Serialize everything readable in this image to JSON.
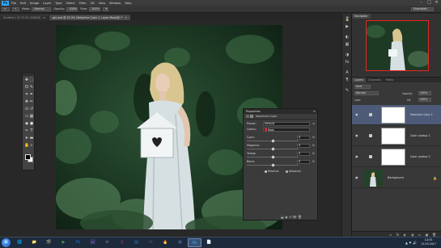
{
  "app": {
    "logo_text": "Ps",
    "menu": [
      "File",
      "Edit",
      "Image",
      "Layer",
      "Type",
      "Select",
      "Filter",
      "3D",
      "View",
      "Window",
      "Help"
    ],
    "window_controls": [
      "–",
      "□",
      "✕"
    ]
  },
  "options": {
    "mode_label": "Mode:",
    "mode_value": "Normal",
    "opacity_label": "Opacity:",
    "opacity_value": "100%",
    "flow_label": "Flow:",
    "flow_value": "100%",
    "workspace": "Essentials"
  },
  "tabs": [
    {
      "label": "Untitled-1 @ 33.3% (RGB/8)",
      "active": false
    },
    {
      "label": "girl.psd @ 33.3% (Selective Color 1, Layer Mask/8) *",
      "active": true
    }
  ],
  "tools": {
    "icons": [
      "move-icon",
      "marquee-icon",
      "lasso-icon",
      "quick-select-icon",
      "crop-icon",
      "eyedropper-icon",
      "healing-icon",
      "brush-icon",
      "stamp-icon",
      "history-brush-icon",
      "eraser-icon",
      "gradient-icon",
      "blur-icon",
      "dodge-icon",
      "pen-icon",
      "type-icon",
      "path-select-icon",
      "shape-icon",
      "hand-icon",
      "zoom-icon"
    ],
    "glyphs": [
      "✥",
      "⬚",
      "ʘ",
      "✎",
      "⌗",
      "✒",
      "✚",
      "✏",
      "⊙",
      "↺",
      "▭",
      "▦",
      "◆",
      "●",
      "✑",
      "T",
      "➤",
      "▬",
      "✋",
      "⌕"
    ],
    "foreground": "#000000",
    "background": "#ffffff"
  },
  "properties": {
    "title": "Properties",
    "subtitle": "Selective Color",
    "preset_label": "Preset:",
    "preset_value": "Default",
    "colors_label": "Colors:",
    "colors_value": "Reds",
    "rows": [
      {
        "label": "Cyan:",
        "value": "0",
        "unit": "%",
        "knob": 0.5
      },
      {
        "label": "Magenta:",
        "value": "0",
        "unit": "%",
        "knob": 0.5
      },
      {
        "label": "Yellow:",
        "value": "0",
        "unit": "%",
        "knob": 0.5
      },
      {
        "label": "Black:",
        "value": "0",
        "unit": "%",
        "knob": 0.5
      }
    ],
    "method_relative": "Relative",
    "method_absolute": "Absolute",
    "relative_selected": true
  },
  "navigator": {
    "tab": "Navigator"
  },
  "layers": {
    "tabs": [
      "Layers",
      "Channels",
      "Paths"
    ],
    "kind_label": "Kind",
    "blend_value": "Normal",
    "opacity_label": "Opacity:",
    "opacity_value": "100%",
    "lock_label": "Lock:",
    "fill_label": "Fill:",
    "fill_value": "100%",
    "rows": [
      {
        "name": "Selective Color 1",
        "type": "adjustment",
        "selected": true
      },
      {
        "name": "Color Lookup 1",
        "type": "adjustment",
        "selected": false
      },
      {
        "name": "Color Lookup 2",
        "type": "adjustment",
        "selected": false
      },
      {
        "name": "Background",
        "type": "image",
        "selected": false
      }
    ],
    "footer_icons": [
      "∞",
      "fx",
      "◐",
      "◑",
      "▭",
      "▣",
      "🗑"
    ]
  },
  "taskbar": {
    "start": "⊞",
    "apps": [
      "🌐",
      "📁",
      "🎬",
      "▶",
      "Ps",
      "🖼",
      "⚙",
      "♫",
      "▤",
      "✉",
      "🔥",
      "▣",
      "Ps",
      "📄"
    ],
    "app_colors": [
      "#d24a2a",
      "#e4a83a",
      "#3a7bd5",
      "#4aa34a",
      "#1f6fd0",
      "#8a5fc8",
      "#777777",
      "#d84a8a",
      "#2a8ab0",
      "#5a5a5a",
      "#e06a20",
      "#4a6a9a",
      "#31a8ff",
      "#c83a3a"
    ],
    "active_index": 12,
    "time": "14:35",
    "date": "12.03.2017"
  }
}
